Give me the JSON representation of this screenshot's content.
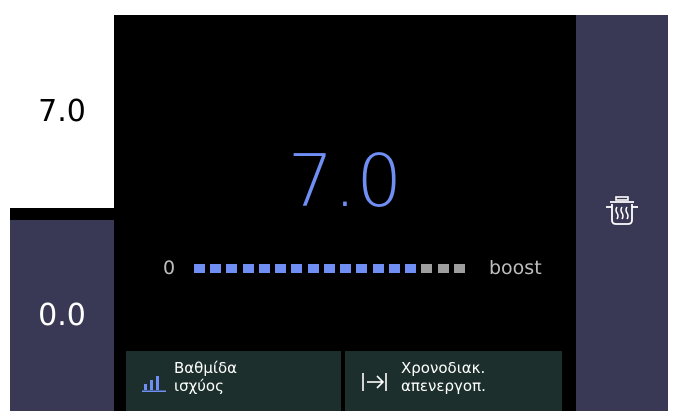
{
  "zones": {
    "top_value": "7.0",
    "bottom_value": "0.0"
  },
  "main": {
    "power_value": "7.0",
    "scale_min": "0",
    "scale_max": "boost"
  },
  "power_bar": {
    "total_segments": 17,
    "active_segments": 14
  },
  "buttons": {
    "power_level_label_1": "Βαθμίδα",
    "power_level_label_2": "ισχύος",
    "timer_label_1": "Χρονοδιακ.",
    "timer_label_2": "απενεργοπ."
  },
  "icons": {
    "right_panel": "pot-steam-icon",
    "power_level": "bar-chart-icon",
    "timer": "arrow-to-line-icon"
  },
  "colors": {
    "accent": "#6f8ff5",
    "inactive_segment": "#9e9e9e",
    "panel": "#3a3955",
    "button_bg": "#1c2f2c"
  }
}
